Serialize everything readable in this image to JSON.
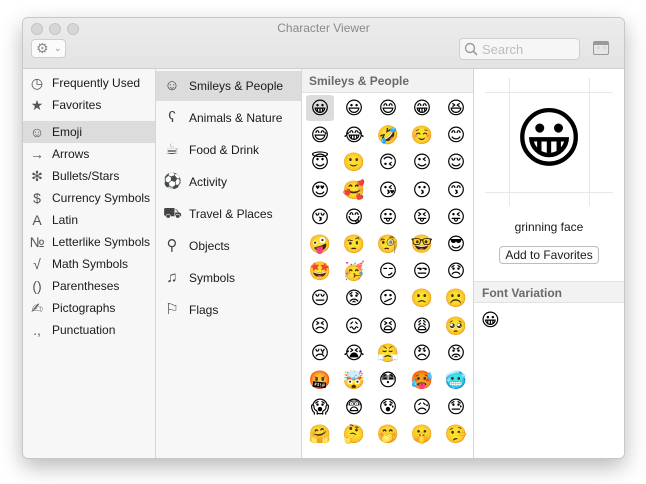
{
  "window": {
    "title": "Character Viewer"
  },
  "toolbar": {
    "search_placeholder": "Search",
    "gear_caret": "⌄"
  },
  "sidebar": {
    "items": [
      {
        "label": "Frequently Used",
        "icon": "clock-icon",
        "glyph": "◷"
      },
      {
        "label": "Favorites",
        "icon": "star-icon",
        "glyph": "★"
      },
      {
        "label": "Emoji",
        "icon": "smiley-icon",
        "glyph": "☺",
        "selected": true
      },
      {
        "label": "Arrows",
        "icon": "arrow-icon",
        "glyph": "→"
      },
      {
        "label": "Bullets/Stars",
        "icon": "asterisk-icon",
        "glyph": "✻"
      },
      {
        "label": "Currency Symbols",
        "icon": "dollar-icon",
        "glyph": "$"
      },
      {
        "label": "Latin",
        "icon": "latin-a-icon",
        "glyph": "A"
      },
      {
        "label": "Letterlike Symbols",
        "icon": "numero-icon",
        "glyph": "№"
      },
      {
        "label": "Math Symbols",
        "icon": "square-root-icon",
        "glyph": "√"
      },
      {
        "label": "Parentheses",
        "icon": "parentheses-icon",
        "glyph": "()"
      },
      {
        "label": "Pictographs",
        "icon": "pencil-icon",
        "glyph": "✍"
      },
      {
        "label": "Punctuation",
        "icon": "punctuation-icon",
        "glyph": ".,"
      }
    ]
  },
  "categories": {
    "items": [
      {
        "label": "Smileys & People",
        "icon": "smiley-face-icon",
        "glyph": "☺",
        "selected": true
      },
      {
        "label": "Animals & Nature",
        "icon": "bear-icon",
        "glyph": "ʕ"
      },
      {
        "label": "Food & Drink",
        "icon": "cup-icon",
        "glyph": "☕"
      },
      {
        "label": "Activity",
        "icon": "soccer-ball-icon",
        "glyph": "⚽"
      },
      {
        "label": "Travel & Places",
        "icon": "car-icon",
        "glyph": "⛟"
      },
      {
        "label": "Objects",
        "icon": "lightbulb-icon",
        "glyph": "⚲"
      },
      {
        "label": "Symbols",
        "icon": "symbols-icon",
        "glyph": "♫"
      },
      {
        "label": "Flags",
        "icon": "flag-icon",
        "glyph": "⚐"
      }
    ]
  },
  "emoji_panel": {
    "header": "Smileys & People",
    "emojis": [
      "😀",
      "😃",
      "😄",
      "😁",
      "😆",
      "😅",
      "😂",
      "🤣",
      "☺️",
      "😊",
      "😇",
      "🙂",
      "🙃",
      "😉",
      "😌",
      "😍",
      "🥰",
      "😘",
      "😗",
      "😙",
      "😚",
      "😋",
      "😛",
      "😝",
      "😜",
      "🤪",
      "🤨",
      "🧐",
      "🤓",
      "😎",
      "🤩",
      "🥳",
      "😏",
      "😒",
      "😞",
      "😔",
      "😟",
      "😕",
      "🙁",
      "☹️",
      "😣",
      "😖",
      "😫",
      "😩",
      "🥺",
      "😢",
      "😭",
      "😤",
      "😠",
      "😡",
      "🤬",
      "🤯",
      "😳",
      "🥵",
      "🥶",
      "😱",
      "😨",
      "😰",
      "😥",
      "😓",
      "🤗",
      "🤔",
      "🤭",
      "🤫",
      "🤥"
    ]
  },
  "detail": {
    "preview_emoji": "😀",
    "name": "grinning face",
    "add_favorites_label": "Add to Favorites",
    "font_variation_header": "Font Variation",
    "variation_emoji": "😀"
  }
}
